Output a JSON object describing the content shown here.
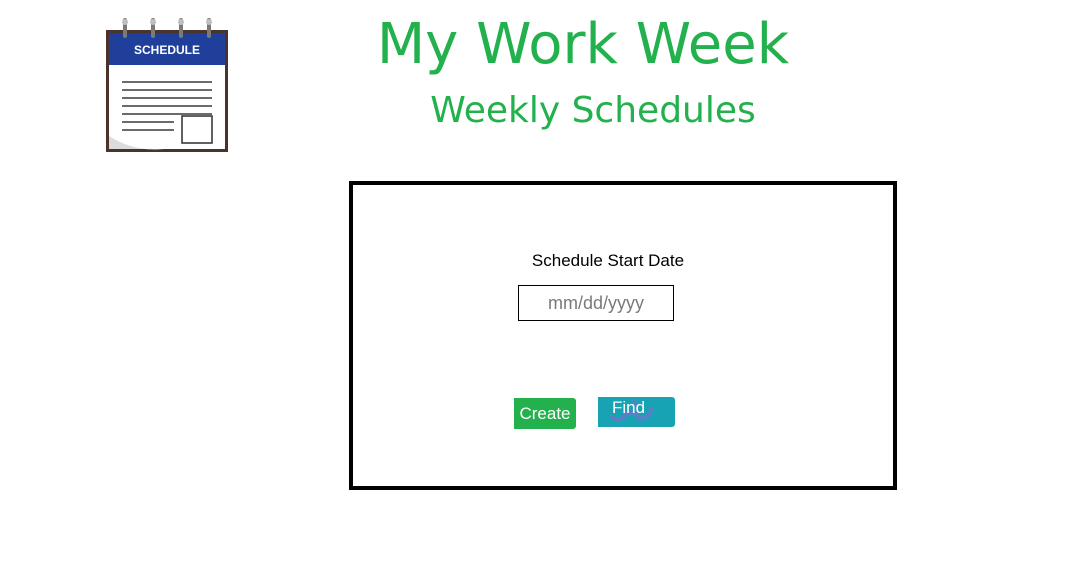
{
  "header": {
    "title": "My Work Week",
    "subtitle": "Weekly Schedules"
  },
  "logo": {
    "icon": "schedule-calendar-icon",
    "label": "SCHEDULE"
  },
  "form": {
    "start_date_label": "Schedule Start Date",
    "start_date_placeholder": "mm/dd/yyyy",
    "start_date_value": "",
    "create_label": "Create",
    "find_label": "Find"
  },
  "colors": {
    "title_green": "#22b14c",
    "create_button": "#22b14c",
    "find_button": "#18a3b5",
    "logo_header_blue": "#1f3f9a",
    "panel_border": "#000000"
  }
}
